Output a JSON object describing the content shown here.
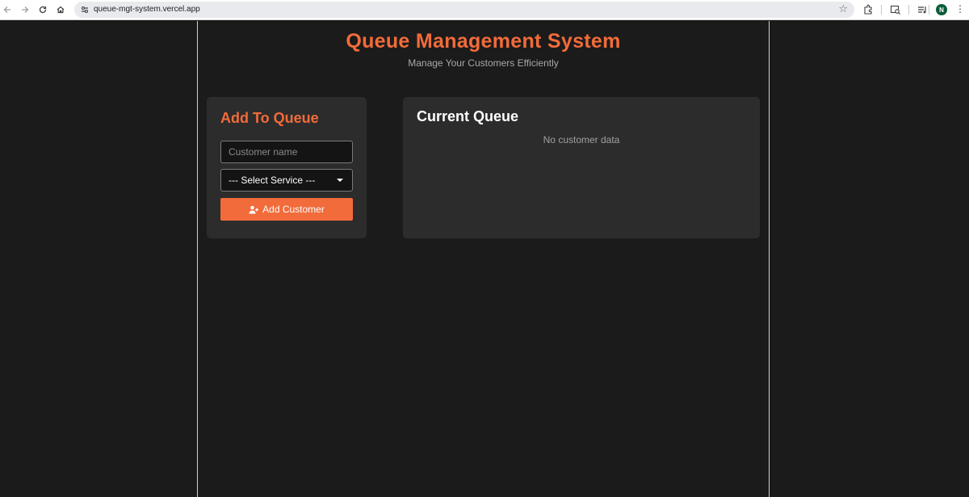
{
  "browser": {
    "url": "queue-mgt-system.vercel.app",
    "avatar_initial": "N"
  },
  "header": {
    "title": "Queue Management System",
    "subtitle": "Manage Your Customers Efficiently"
  },
  "add_card": {
    "title": "Add To Queue",
    "name_placeholder": "Customer name",
    "name_value": "",
    "service_selected": "--- Select Service ---",
    "add_button_label": "Add Customer"
  },
  "queue_card": {
    "title": "Current Queue",
    "empty_text": "No customer data"
  },
  "colors": {
    "accent": "#f26b3a",
    "background": "#1b1b1b",
    "card": "#2c2c2c"
  }
}
